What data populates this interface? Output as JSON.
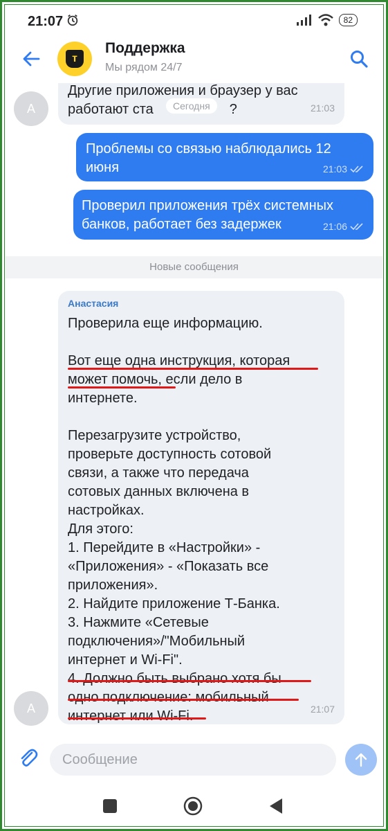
{
  "status_bar": {
    "time": "21:07",
    "battery": "82"
  },
  "header": {
    "title": "Поддержка",
    "subtitle": "Мы рядом 24/7",
    "logo_letter": "т"
  },
  "chat": {
    "date_pill": "Сегодня",
    "divider": "Новые сообщения",
    "messages": [
      {
        "direction": "incoming",
        "avatar": "А",
        "text_line1": "Другие приложения и браузер у вас",
        "text_line2": "работают ста",
        "text_line2_end": "?",
        "time": "21:03"
      },
      {
        "direction": "outgoing",
        "text_line1": "Проблемы со связью наблюдались 12",
        "text_line2": "июня",
        "time": "21:03"
      },
      {
        "direction": "outgoing",
        "text_line1": "Проверил приложения трёх системных",
        "text_line2": "банков, работает без задержек",
        "time": "21:06"
      },
      {
        "direction": "incoming",
        "avatar": "А",
        "sender": "Анастасия",
        "lines": [
          "Проверила еще информацию.",
          "",
          "Вот еще одна инструкция, которая",
          "может помочь, если дело в",
          "интернете.",
          "",
          "Перезагрузите устройство,",
          "проверьте доступность сотовой",
          "связи, а также что передача",
          "сотовых данных включена в",
          "настройках.",
          "Для этого:",
          "1. Перейдите в «Настройки» -",
          "«Приложения» - «Показать все",
          "приложения».",
          "2. Найдите приложение Т-Банка.",
          "3. Нажмите «Сетевые",
          "подключения»/\"Мобильный",
          "интернет и Wi-Fi\".",
          "4. Должно быть выбрано хотя бы",
          "одно подключение: мобильный",
          "интернет или Wi-Fi."
        ],
        "time": "21:07"
      }
    ]
  },
  "composer": {
    "placeholder": "Сообщение"
  },
  "colors": {
    "accent": "#2f7cf0",
    "brand_yellow": "#fed12a",
    "underline_red": "#e01818"
  }
}
